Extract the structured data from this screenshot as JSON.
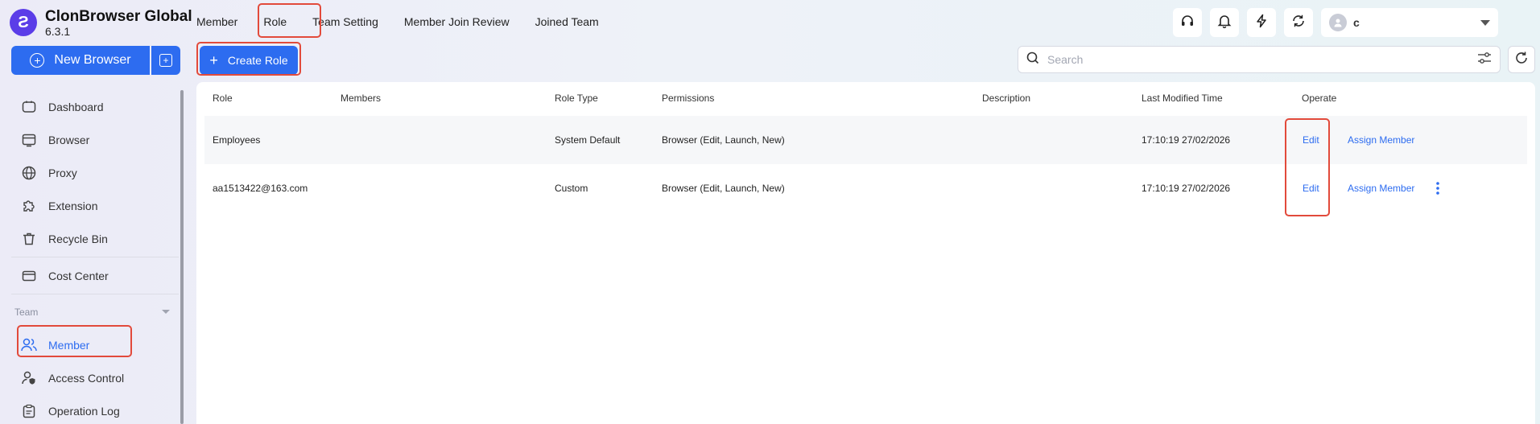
{
  "app": {
    "name": "ClonBrowser Global",
    "version": "6.3.1",
    "logo_letter": "Ƨ"
  },
  "sidebar": {
    "new_browser_label": "New Browser",
    "items": [
      {
        "label": "Dashboard",
        "icon": "dashboard-icon"
      },
      {
        "label": "Browser",
        "icon": "browser-icon"
      },
      {
        "label": "Proxy",
        "icon": "globe-icon"
      },
      {
        "label": "Extension",
        "icon": "puzzle-icon"
      },
      {
        "label": "Recycle Bin",
        "icon": "trash-icon"
      },
      {
        "label": "Cost Center",
        "icon": "wallet-icon"
      }
    ],
    "team_group_label": "Team",
    "team_items": [
      {
        "label": "Member",
        "icon": "users-icon",
        "active": true
      },
      {
        "label": "Access Control",
        "icon": "user-shield-icon"
      },
      {
        "label": "Operation Log",
        "icon": "clipboard-icon"
      }
    ]
  },
  "tabs": [
    "Member",
    "Role",
    "Team Setting",
    "Member Join Review",
    "Joined Team"
  ],
  "active_tab": "Role",
  "header": {
    "user_initial": "c"
  },
  "toolbar": {
    "create_role_label": "Create Role",
    "search_placeholder": "Search"
  },
  "table": {
    "columns": [
      "Role",
      "Members",
      "Role Type",
      "Permissions",
      "Description",
      "Last Modified Time",
      "Operate"
    ],
    "rows": [
      {
        "role": "Employees",
        "members": "",
        "role_type": "System Default",
        "permissions": "Browser (Edit, Launch, New)",
        "description": "",
        "modified": "17:10:19 27/02/2026",
        "edit": "Edit",
        "assign": "Assign Member",
        "has_more": false
      },
      {
        "role": "aa1513422@163.com",
        "members": "",
        "role_type": "Custom",
        "permissions": "Browser (Edit, Launch, New)",
        "description": "",
        "modified": "17:10:19 27/02/2026",
        "edit": "Edit",
        "assign": "Assign Member",
        "has_more": true
      }
    ]
  },
  "colors": {
    "accent": "#2d6cf0",
    "highlight": "#e24a3b",
    "logo": "#5b3de8"
  }
}
